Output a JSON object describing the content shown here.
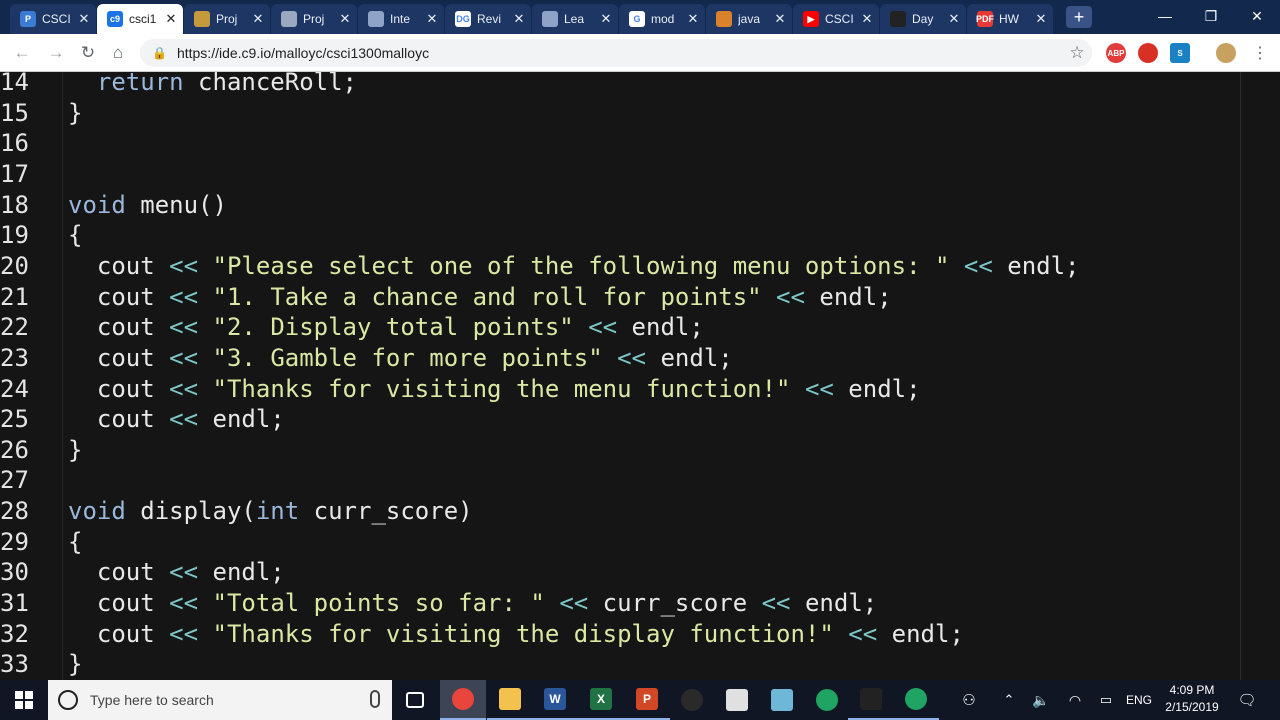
{
  "browser": {
    "tabs": [
      {
        "title": "CSCI",
        "fav_text": "P",
        "fav_color": "#3b7bd4",
        "active": false
      },
      {
        "title": "csci1",
        "fav_text": "c9",
        "fav_color": "#1a73e8",
        "active": true
      },
      {
        "title": "Proj",
        "fav_text": "",
        "fav_color": "#c49a3c",
        "active": false
      },
      {
        "title": "Proj",
        "fav_text": "",
        "fav_color": "#9aa8c0",
        "active": false
      },
      {
        "title": "Inte",
        "fav_text": "",
        "fav_color": "#8fa3c8",
        "active": false
      },
      {
        "title": "Revi",
        "fav_text": "DG",
        "fav_color": "#ffffff",
        "active": false
      },
      {
        "title": "Lea",
        "fav_text": "",
        "fav_color": "#8fa3c8",
        "active": false
      },
      {
        "title": "mod",
        "fav_text": "G",
        "fav_color": "#ffffff",
        "active": false
      },
      {
        "title": "java",
        "fav_text": "",
        "fav_color": "#d9822b",
        "active": false
      },
      {
        "title": "CSCI",
        "fav_text": "▶",
        "fav_color": "#ff0000",
        "active": false
      },
      {
        "title": "Day",
        "fav_text": "",
        "fav_color": "#222222",
        "active": false
      },
      {
        "title": "HW",
        "fav_text": "PDF",
        "fav_color": "#e53935",
        "active": false
      }
    ],
    "url": "https://ide.c9.io/malloyc/csci1300malloyc",
    "extensions": [
      {
        "label": "ABP",
        "color": "#e23b3b"
      },
      {
        "label": "",
        "color": "#d93025"
      },
      {
        "label": "S",
        "color": "#1a82c4"
      },
      {
        "label": "",
        "color": "#c8a060"
      }
    ]
  },
  "editor": {
    "lines": [
      {
        "num": "14",
        "tokens": [
          {
            "t": "  return chanceRoll;",
            "c": "kwline"
          }
        ]
      },
      {
        "num": "15",
        "tokens": [
          {
            "t": "}",
            "c": "plain"
          }
        ]
      },
      {
        "num": "16",
        "tokens": []
      },
      {
        "num": "17",
        "tokens": []
      },
      {
        "num": "18",
        "tokens": [
          {
            "t": "void",
            "c": "kw"
          },
          {
            "t": " menu()",
            "c": "plain"
          }
        ]
      },
      {
        "num": "19",
        "tokens": [
          {
            "t": "{",
            "c": "plain"
          }
        ]
      },
      {
        "num": "20",
        "tokens": [
          {
            "t": "  cout ",
            "c": "plain"
          },
          {
            "t": "<<",
            "c": "op"
          },
          {
            "t": " ",
            "c": "plain"
          },
          {
            "t": "\"Please select one of the following menu options: \"",
            "c": "str"
          },
          {
            "t": " ",
            "c": "plain"
          },
          {
            "t": "<<",
            "c": "op"
          },
          {
            "t": " endl;",
            "c": "plain"
          }
        ]
      },
      {
        "num": "21",
        "tokens": [
          {
            "t": "  cout ",
            "c": "plain"
          },
          {
            "t": "<<",
            "c": "op"
          },
          {
            "t": " ",
            "c": "plain"
          },
          {
            "t": "\"1. Take a chance and roll for points\"",
            "c": "str"
          },
          {
            "t": " ",
            "c": "plain"
          },
          {
            "t": "<<",
            "c": "op"
          },
          {
            "t": " endl;",
            "c": "plain"
          }
        ]
      },
      {
        "num": "22",
        "tokens": [
          {
            "t": "  cout ",
            "c": "plain"
          },
          {
            "t": "<<",
            "c": "op"
          },
          {
            "t": " ",
            "c": "plain"
          },
          {
            "t": "\"2. Display total points\"",
            "c": "str"
          },
          {
            "t": " ",
            "c": "plain"
          },
          {
            "t": "<<",
            "c": "op"
          },
          {
            "t": " endl;",
            "c": "plain"
          }
        ]
      },
      {
        "num": "23",
        "tokens": [
          {
            "t": "  cout ",
            "c": "plain"
          },
          {
            "t": "<<",
            "c": "op"
          },
          {
            "t": " ",
            "c": "plain"
          },
          {
            "t": "\"3. Gamble for more points\"",
            "c": "str"
          },
          {
            "t": " ",
            "c": "plain"
          },
          {
            "t": "<<",
            "c": "op"
          },
          {
            "t": " endl;",
            "c": "plain"
          }
        ]
      },
      {
        "num": "24",
        "tokens": [
          {
            "t": "  cout ",
            "c": "plain"
          },
          {
            "t": "<<",
            "c": "op"
          },
          {
            "t": " ",
            "c": "plain"
          },
          {
            "t": "\"Thanks for visiting the menu function!\"",
            "c": "str"
          },
          {
            "t": " ",
            "c": "plain"
          },
          {
            "t": "<<",
            "c": "op"
          },
          {
            "t": " endl;",
            "c": "plain"
          }
        ]
      },
      {
        "num": "25",
        "tokens": [
          {
            "t": "  cout ",
            "c": "plain"
          },
          {
            "t": "<<",
            "c": "op"
          },
          {
            "t": " endl;",
            "c": "plain"
          }
        ]
      },
      {
        "num": "26",
        "tokens": [
          {
            "t": "}",
            "c": "plain"
          }
        ]
      },
      {
        "num": "27",
        "tokens": []
      },
      {
        "num": "28",
        "tokens": [
          {
            "t": "void",
            "c": "kw"
          },
          {
            "t": " display(",
            "c": "plain"
          },
          {
            "t": "int",
            "c": "kw"
          },
          {
            "t": " curr_score)",
            "c": "plain"
          }
        ]
      },
      {
        "num": "29",
        "tokens": [
          {
            "t": "{",
            "c": "plain"
          }
        ]
      },
      {
        "num": "30",
        "tokens": [
          {
            "t": "  cout ",
            "c": "plain"
          },
          {
            "t": "<<",
            "c": "op"
          },
          {
            "t": " endl;",
            "c": "plain"
          }
        ]
      },
      {
        "num": "31",
        "tokens": [
          {
            "t": "  cout ",
            "c": "plain"
          },
          {
            "t": "<<",
            "c": "op"
          },
          {
            "t": " ",
            "c": "plain"
          },
          {
            "t": "\"Total points so far: \"",
            "c": "str"
          },
          {
            "t": " ",
            "c": "plain"
          },
          {
            "t": "<<",
            "c": "op"
          },
          {
            "t": " curr_score ",
            "c": "plain"
          },
          {
            "t": "<<",
            "c": "op"
          },
          {
            "t": " endl;",
            "c": "plain"
          }
        ]
      },
      {
        "num": "32",
        "tokens": [
          {
            "t": "  cout ",
            "c": "plain"
          },
          {
            "t": "<<",
            "c": "op"
          },
          {
            "t": " ",
            "c": "plain"
          },
          {
            "t": "\"Thanks for visiting the display function!\"",
            "c": "str"
          },
          {
            "t": " ",
            "c": "plain"
          },
          {
            "t": "<<",
            "c": "op"
          },
          {
            "t": " endl;",
            "c": "plain"
          }
        ]
      },
      {
        "num": "33",
        "tokens": [
          {
            "t": "}",
            "c": "plain"
          }
        ]
      }
    ]
  },
  "taskbar": {
    "search_placeholder": "Type here to search",
    "apps": [
      {
        "name": "task-view",
        "label": "",
        "color": "#101623",
        "icon": "task-view-icon"
      },
      {
        "name": "chrome",
        "label": "",
        "color": "#e8453c",
        "icon": "chrome-icon",
        "state": "active"
      },
      {
        "name": "file-explorer",
        "label": "",
        "color": "#f2c14e",
        "icon": "folder-icon",
        "state": "open"
      },
      {
        "name": "word",
        "label": "W",
        "color": "#2b579a",
        "icon": "word-icon",
        "state": "open"
      },
      {
        "name": "excel",
        "label": "X",
        "color": "#217346",
        "icon": "excel-icon",
        "state": "open"
      },
      {
        "name": "powerpoint",
        "label": "P",
        "color": "#d24726",
        "icon": "powerpoint-icon",
        "state": "open"
      },
      {
        "name": "obs",
        "label": "",
        "color": "#2a2a2a",
        "icon": "obs-icon"
      },
      {
        "name": "calculator",
        "label": "",
        "color": "#e0e0e0",
        "icon": "calculator-icon"
      },
      {
        "name": "paint",
        "label": "",
        "color": "#6fb7d8",
        "icon": "paint-icon"
      },
      {
        "name": "green-app-1",
        "label": "",
        "color": "#1fa463",
        "icon": "green-app-icon"
      },
      {
        "name": "terminal",
        "label": "",
        "color": "#222222",
        "icon": "terminal-icon",
        "state": "open"
      },
      {
        "name": "green-app-2",
        "label": "",
        "color": "#1fa463",
        "icon": "green-app-icon",
        "state": "open"
      }
    ],
    "language": "ENG",
    "time": "4:09 PM",
    "date": "2/15/2019"
  }
}
